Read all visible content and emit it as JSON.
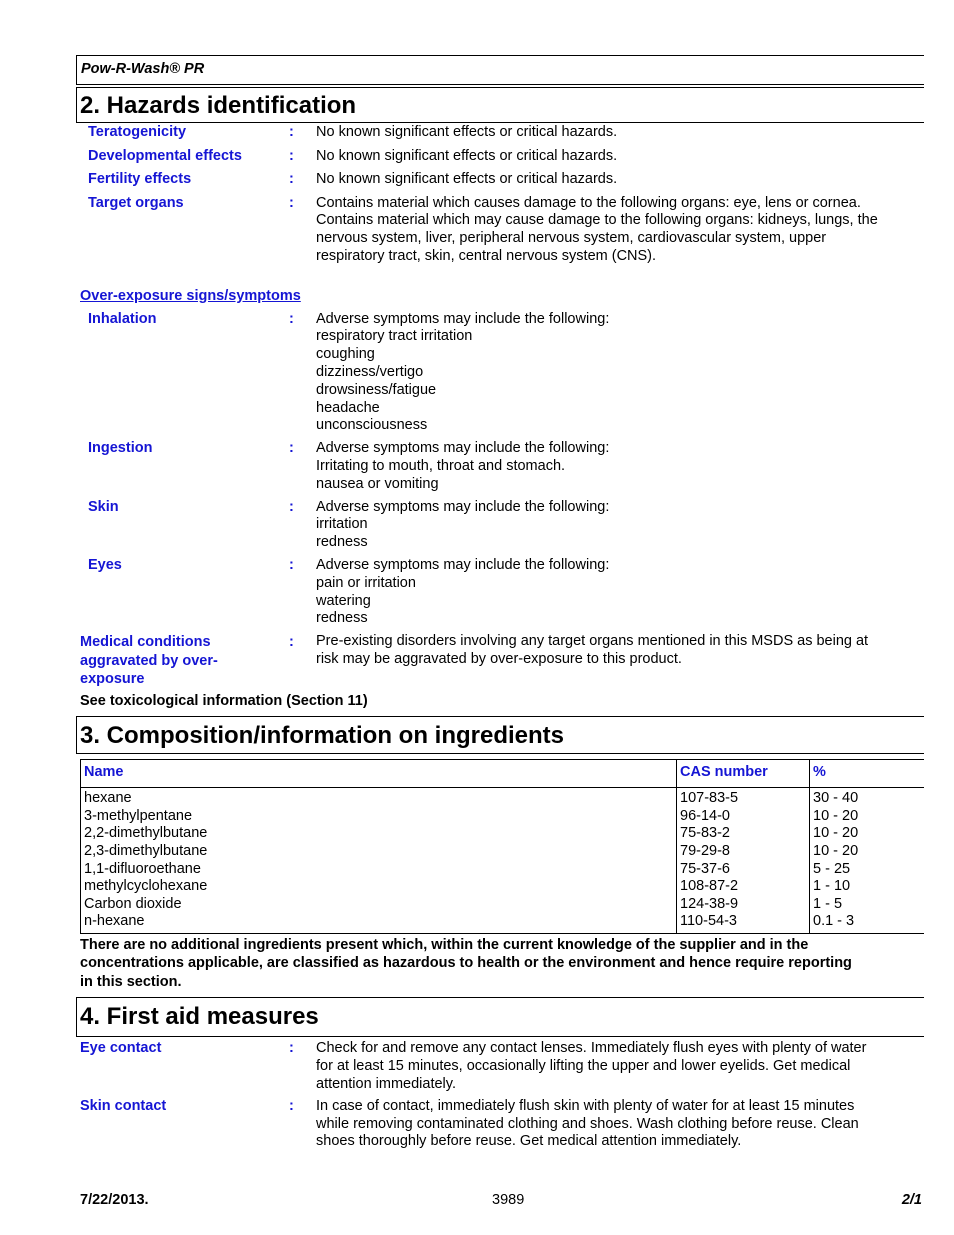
{
  "header": {
    "product_name": "Pow-R-Wash® PR"
  },
  "section2": {
    "title": "2. Hazards identification",
    "items": [
      {
        "label": "Teratogenicity",
        "lines": [
          "No known significant effects or critical hazards."
        ]
      },
      {
        "label": "Developmental effects",
        "lines": [
          "No known significant effects or critical hazards."
        ]
      },
      {
        "label": "Fertility effects",
        "lines": [
          "No known significant effects or critical hazards."
        ]
      },
      {
        "label": "Target organs",
        "lines": [
          "Contains material which causes damage to the following organs: eye, lens or cornea.",
          "Contains material which may cause damage to the following organs: kidneys, lungs, the",
          "nervous system, liver, peripheral nervous system, cardiovascular system, upper",
          "respiratory tract, skin, central nervous system (CNS)."
        ]
      }
    ],
    "overexposure_heading": "Over-exposure signs/symptoms",
    "symptoms": [
      {
        "label": "Inhalation",
        "lines": [
          "Adverse symptoms may include the following:",
          "respiratory tract irritation",
          "coughing",
          "dizziness/vertigo",
          "drowsiness/fatigue",
          "headache",
          "unconsciousness"
        ]
      },
      {
        "label": "Ingestion",
        "lines": [
          "Adverse symptoms may include the following:",
          "Irritating to mouth, throat and stomach.",
          "nausea or vomiting"
        ]
      },
      {
        "label": "Skin",
        "lines": [
          "Adverse symptoms may include the following:",
          "irritation",
          "redness"
        ]
      },
      {
        "label": "Eyes",
        "lines": [
          "Adverse symptoms may include the following:",
          "pain or irritation",
          "watering",
          "redness"
        ]
      }
    ],
    "medical_conditions": {
      "label_lines": [
        "Medical conditions",
        "aggravated by over-",
        "exposure"
      ],
      "lines": [
        "Pre-existing disorders involving any target organs mentioned in this MSDS as being at",
        "risk may be aggravated by over-exposure to this product."
      ]
    },
    "see_also": "See toxicological information (Section 11)"
  },
  "section3": {
    "title": "3. Composition/information on ingredients",
    "columns": [
      "Name",
      "CAS number",
      "%"
    ],
    "rows": [
      [
        "hexane",
        "107-83-5",
        "30 - 40"
      ],
      [
        "3-methylpentane",
        "96-14-0",
        "10 - 20"
      ],
      [
        "2,2-dimethylbutane",
        "75-83-2",
        "10 - 20"
      ],
      [
        "2,3-dimethylbutane",
        "79-29-8",
        "10 - 20"
      ],
      [
        "1,1-difluoroethane",
        "75-37-6",
        "5 - 25"
      ],
      [
        "methylcyclohexane",
        "108-87-2",
        "1 - 10"
      ],
      [
        "Carbon dioxide",
        "124-38-9",
        "1 - 5"
      ],
      [
        "n-hexane",
        "110-54-3",
        "0.1 - 3"
      ]
    ],
    "note_lines": [
      "There are no additional ingredients present which, within the current knowledge of the supplier and in the",
      "concentrations applicable, are classified as hazardous to health or the environment and hence require reporting",
      "in this section."
    ]
  },
  "section4": {
    "title": "4. First aid measures",
    "items": [
      {
        "label": "Eye contact",
        "lines": [
          "Check for and remove any contact lenses.  Immediately flush eyes with plenty of water",
          "for at least 15 minutes, occasionally lifting the upper and lower eyelids.  Get medical",
          "attention immediately."
        ]
      },
      {
        "label": "Skin contact",
        "lines": [
          "In case of contact, immediately flush skin with plenty of water for at least 15 minutes",
          "while removing contaminated clothing and shoes.  Wash clothing before reuse.  Clean",
          "shoes thoroughly before reuse.  Get medical attention immediately."
        ]
      }
    ]
  },
  "colon": ":",
  "footer": {
    "date": "7/22/2013.",
    "doc_number": "3989",
    "page": "2/1"
  },
  "colors": {
    "label_blue": "#1515d4",
    "text": "#000000"
  }
}
